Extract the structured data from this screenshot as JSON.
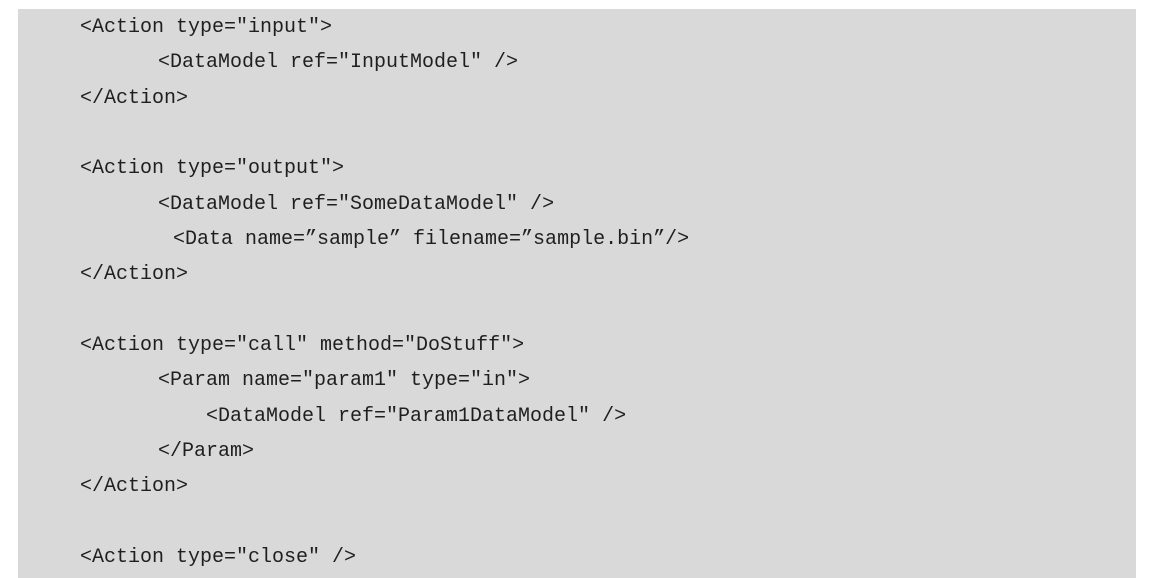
{
  "code_block": {
    "lines": [
      "<Action type=\"input\">",
      "<DataModel ref=\"InputModel\" />",
      "</Action>",
      "",
      "<Action type=\"output\">",
      "<DataModel ref=\"SomeDataModel\" />",
      "<Data name=”sample” filename=”sample.bin”/>",
      "</Action>",
      "",
      "<Action type=\"call\" method=\"DoStuff\">",
      "<Param name=\"param1\" type=\"in\">",
      "<DataModel ref=\"Param1DataModel\" />",
      "</Param>",
      "</Action>",
      "",
      "<Action type=\"close\" />"
    ]
  }
}
